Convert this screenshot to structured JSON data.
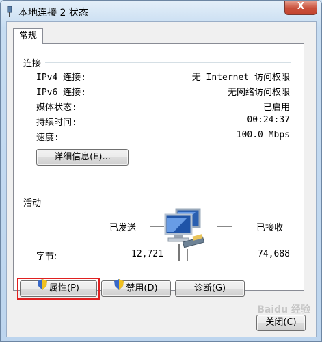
{
  "window": {
    "title": "本地连接 2 状态",
    "close_label": "X"
  },
  "tab": {
    "label": "常规"
  },
  "connection": {
    "heading": "连接",
    "rows": [
      {
        "label": "IPv4 连接:",
        "value": "无 Internet 访问权限"
      },
      {
        "label": "IPv6 连接:",
        "value": "无网络访问权限"
      },
      {
        "label": "媒体状态:",
        "value": "已启用"
      },
      {
        "label": "持续时间:",
        "value": "00:24:37"
      },
      {
        "label": "速度:",
        "value": "100.0 Mbps"
      }
    ],
    "details_button": "详细信息(E)..."
  },
  "activity": {
    "heading": "活动",
    "sent_label": "已发送",
    "received_label": "已接收",
    "bytes_label": "字节:",
    "bytes_sent": "12,721",
    "bytes_received": "74,688"
  },
  "buttons": {
    "properties": "属性(P)",
    "disable": "禁用(D)",
    "diagnose": "诊断(G)",
    "close": "关闭(C)"
  },
  "watermark": "Baidu 经验",
  "colors": {
    "highlight": "#e02020",
    "title_bar": "#c6dcf1",
    "close_button": "#c9503b"
  }
}
